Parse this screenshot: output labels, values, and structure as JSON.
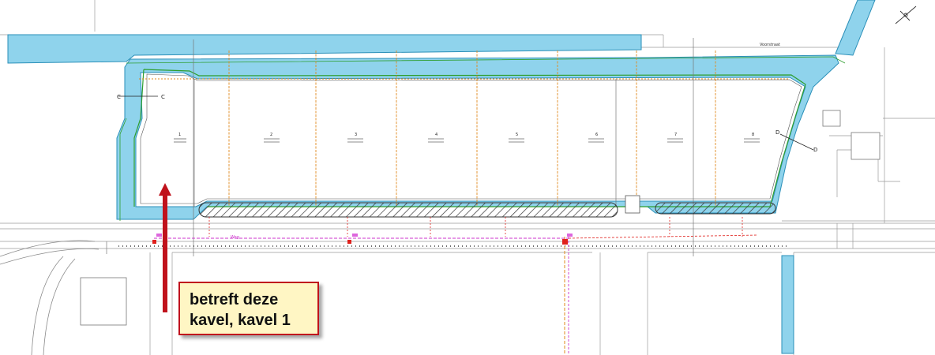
{
  "callout": {
    "line1": "betreft deze",
    "line2": "kavel, kavel 1",
    "border_color": "#c0121c",
    "background_color": "#fff6c4"
  },
  "arrow": {
    "color": "#c0121c",
    "points_to": "kavel 1"
  },
  "plots": [
    {
      "number": "1"
    },
    {
      "number": "2"
    },
    {
      "number": "3"
    },
    {
      "number": "4"
    },
    {
      "number": "5"
    },
    {
      "number": "6"
    },
    {
      "number": "7"
    },
    {
      "number": "8"
    }
  ],
  "labels": {
    "section_c": "C",
    "section_d": "D",
    "street_right": "Voorstraat",
    "street_road": "Weg"
  },
  "colors": {
    "water": "#8fd3ec",
    "water_edge": "#2a8fb8",
    "green_edge": "#2e9e2e",
    "plot_divider": "#e08a1e",
    "hatch": "#333333",
    "utility_magenta": "#cc33cc",
    "utility_red": "#e0201c"
  },
  "icons": [
    "north-arrow-icon",
    "red-pointer-arrow-icon"
  ]
}
